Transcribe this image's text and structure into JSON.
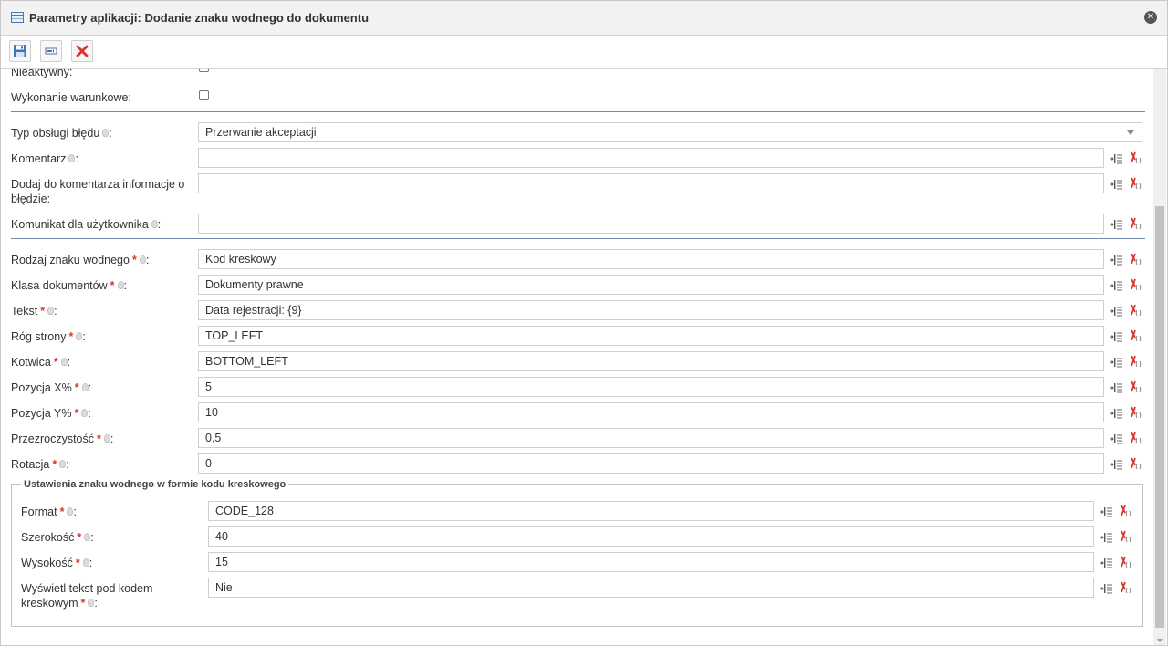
{
  "window": {
    "title": "Parametry aplikacji: Dodanie znaku wodnego do dokumentu"
  },
  "toolbar": {
    "buttons": [
      "save-icon",
      "run-icon",
      "delete-icon"
    ]
  },
  "form": {
    "inactive_label": "Nieaktywny:",
    "conditional_label": "Wykonanie warunkowe:",
    "error_type_label": "Typ obsługi błędu",
    "error_type_value": "Przerwanie akceptacji",
    "comment_label": "Komentarz",
    "comment_value": "",
    "add_error_info_label": "Dodaj do komentarza informacje o błędzie:",
    "add_error_info_value": "",
    "user_message_label": "Komunikat dla użytkownika",
    "user_message_value": "",
    "watermark_type_label": "Rodzaj znaku wodnego",
    "watermark_type_value": "Kod kreskowy",
    "doc_class_label": "Klasa dokumentów",
    "doc_class_value": "Dokumenty prawne",
    "text_label": "Tekst",
    "text_value": "Data rejestracji: {9}",
    "corner_label": "Róg strony",
    "corner_value": "TOP_LEFT",
    "anchor_label": "Kotwica",
    "anchor_value": "BOTTOM_LEFT",
    "pos_x_label": "Pozycja X%",
    "pos_x_value": "5",
    "pos_y_label": "Pozycja Y%",
    "pos_y_value": "10",
    "opacity_label": "Przezroczystość",
    "opacity_value": "0,5",
    "rotation_label": "Rotacja",
    "rotation_value": "0"
  },
  "barcode": {
    "legend": "Ustawienia znaku wodnego w formie kodu kreskowego",
    "format_label": "Format",
    "format_value": "CODE_128",
    "width_label": "Szerokość",
    "width_value": "40",
    "height_label": "Wysokość",
    "height_value": "15",
    "show_text_label_1": "Wyświetl tekst pod kodem",
    "show_text_label_2": "kreskowym",
    "show_text_value": "Nie"
  },
  "colon": ":",
  "required_mark": "*"
}
